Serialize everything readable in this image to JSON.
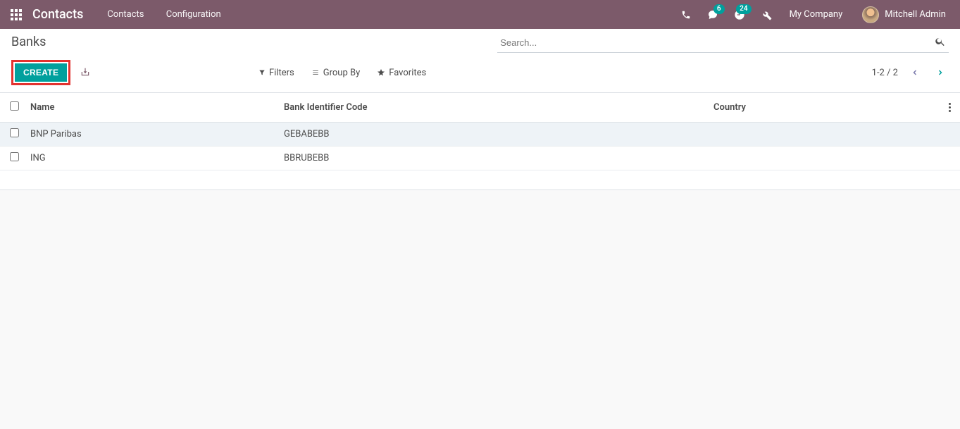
{
  "navbar": {
    "brand": "Contacts",
    "menu": {
      "contacts": "Contacts",
      "configuration": "Configuration"
    },
    "messages_badge": "6",
    "activities_badge": "24",
    "company": "My Company",
    "user": "Mitchell Admin"
  },
  "control": {
    "breadcrumb": "Banks",
    "search_placeholder": "Search...",
    "create_label": "CREATE",
    "filters_label": "Filters",
    "groupby_label": "Group By",
    "favorites_label": "Favorites",
    "pager": "1-2 / 2"
  },
  "table": {
    "headers": {
      "name": "Name",
      "bic": "Bank Identifier Code",
      "country": "Country"
    },
    "rows": [
      {
        "name": "BNP Paribas",
        "bic": "GEBABEBB",
        "country": ""
      },
      {
        "name": "ING",
        "bic": "BBRUBEBB",
        "country": ""
      }
    ]
  }
}
